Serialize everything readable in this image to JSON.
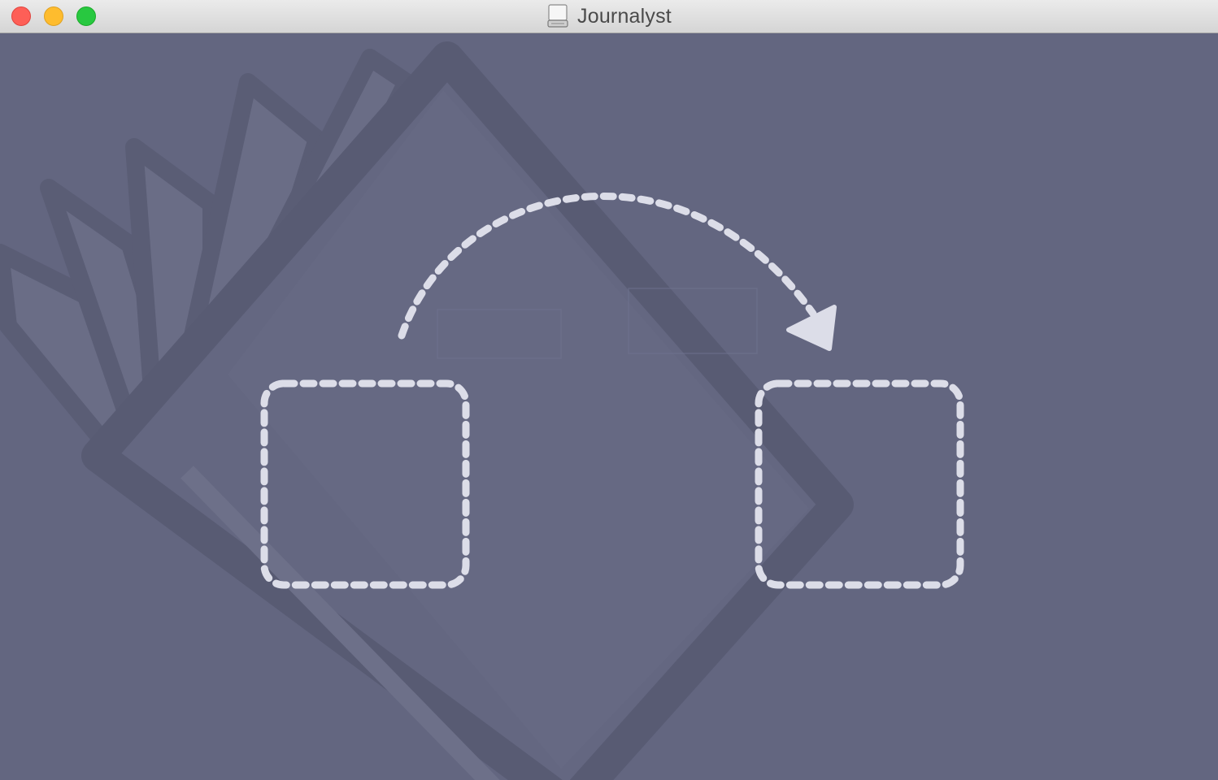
{
  "window": {
    "title": "Journalyst",
    "title_icon": "drive-icon",
    "controls": [
      "close-button",
      "minimize-button",
      "zoom-button"
    ]
  },
  "drop_zone": {
    "source_box_icon": "dashed-square-icon",
    "target_box_icon": "dashed-square-icon",
    "arrow_icon": "curved-dashed-arrow-icon",
    "background_icon": "journal-book-icon"
  },
  "colors": {
    "background": "#636680",
    "dashed_stroke": "#dcdde8",
    "book_shadow": "#585b73",
    "book_page": "#6b6e88",
    "close": "#fe5f57",
    "minimize": "#febc2e",
    "zoom": "#28c840"
  }
}
